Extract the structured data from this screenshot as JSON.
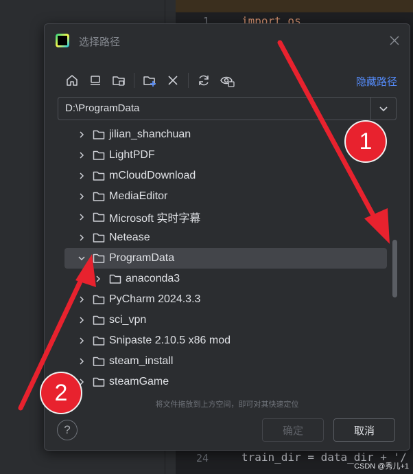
{
  "ide": {
    "code_top": "import os",
    "line_top": "1",
    "line_bottom": "24",
    "code_bottom": "train_dir = data_dir + '/"
  },
  "dialog": {
    "title": "选择路径",
    "hide_path_label": "隐藏路径",
    "path_value": "D:\\ProgramData",
    "hint": "将文件拖放到上方空间，即可对其快速定位",
    "ok_label": "确定",
    "cancel_label": "取消",
    "help_label": "?"
  },
  "toolbar_icons": [
    "home-icon",
    "desktop-icon",
    "project-folder-icon",
    "new-folder-icon",
    "delete-icon",
    "refresh-icon",
    "show-hidden-icon"
  ],
  "tree": [
    {
      "label": "jilian_shanchuan",
      "expanded": false,
      "level": 0
    },
    {
      "label": "LightPDF",
      "expanded": false,
      "level": 0
    },
    {
      "label": "mCloudDownload",
      "expanded": false,
      "level": 0
    },
    {
      "label": "MediaEditor",
      "expanded": false,
      "level": 0
    },
    {
      "label": "Microsoft 实时字幕",
      "expanded": false,
      "level": 0
    },
    {
      "label": "Netease",
      "expanded": false,
      "level": 0
    },
    {
      "label": "ProgramData",
      "expanded": true,
      "level": 0,
      "selected": true
    },
    {
      "label": "anaconda3",
      "expanded": false,
      "level": 1
    },
    {
      "label": "PyCharm 2024.3.3",
      "expanded": false,
      "level": 0
    },
    {
      "label": "sci_vpn",
      "expanded": false,
      "level": 0
    },
    {
      "label": "Snipaste 2.10.5 x86 mod",
      "expanded": false,
      "level": 0
    },
    {
      "label": "steam_install",
      "expanded": false,
      "level": 0
    },
    {
      "label": "steamGame",
      "expanded": false,
      "level": 0
    }
  ],
  "annotations": {
    "badge_1": "1",
    "badge_2": "2",
    "color": "#e8222e"
  },
  "watermark": "CSDN @秀儿+1",
  "colors": {
    "accent_link": "#548af7",
    "dialog_bg": "#2b2d30",
    "selection_bg": "#43454a"
  }
}
